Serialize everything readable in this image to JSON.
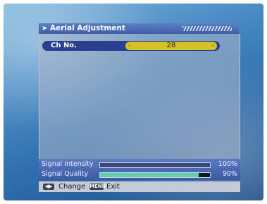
{
  "menu": {
    "title": "Aerial Adjustment",
    "title_arrow": "➤",
    "ch_no": {
      "label": "Ch No.",
      "value": "28",
      "arrow_left": "‹",
      "arrow_right": "›"
    }
  },
  "signal": {
    "intensity": {
      "label": "Signal Intensity",
      "percent": "100%",
      "level": 1.0,
      "color": "#3a4a78"
    },
    "quality": {
      "label": "Signal Quality",
      "percent": "90%",
      "level": 0.9,
      "color": "#5fd0a8"
    }
  },
  "footer": {
    "lr_key": "◀▶",
    "change_label": "Change",
    "menu_key": "MENU",
    "exit_label": "Exit"
  }
}
